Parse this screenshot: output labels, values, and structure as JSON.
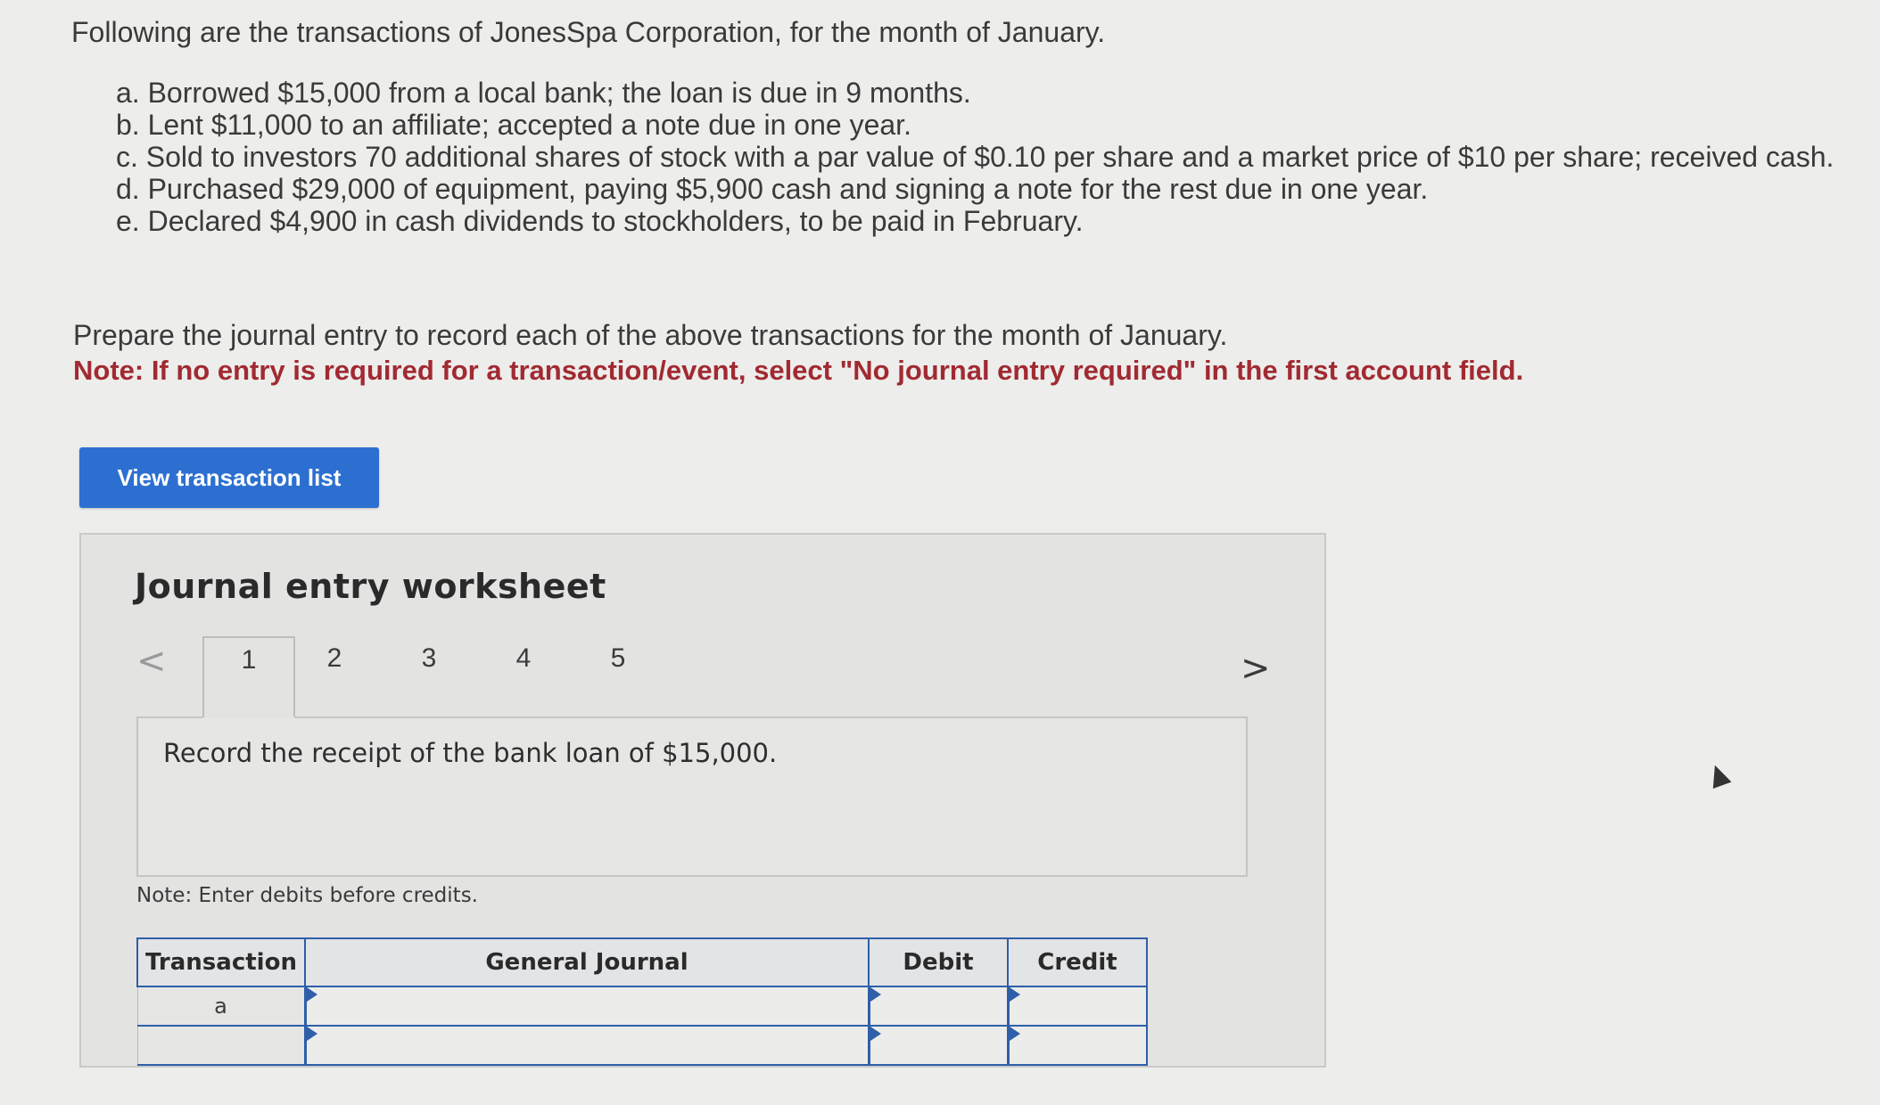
{
  "intro": "Following are the transactions of JonesSpa Corporation, for the month of January.",
  "transactions": [
    "a. Borrowed $15,000 from a local bank; the loan is due in 9 months.",
    "b. Lent $11,000 to an affiliate; accepted a note due in one year.",
    "c. Sold to investors 70 additional shares of stock with a par value of $0.10 per share and a market price of $10 per share; received cash.",
    "d. Purchased $29,000 of equipment, paying $5,900 cash and signing a note for the rest due in one year.",
    "e. Declared $4,900 in cash dividends to stockholders, to be paid in February."
  ],
  "prepare": "Prepare the journal entry to record each of the above transactions for the month of January.",
  "note": "Note: If no entry is required for a transaction/event, select \"No journal entry required\" in the first account field.",
  "view_button": "View transaction list",
  "worksheet": {
    "title": "Journal entry worksheet",
    "prev_icon": "<",
    "next_icon": ">",
    "tabs": [
      "1",
      "2",
      "3",
      "4",
      "5"
    ],
    "active_tab": "1",
    "description": "Record the receipt of the bank loan of $15,000.",
    "enter_note": "Note: Enter debits before credits.",
    "table": {
      "headers": {
        "transaction": "Transaction",
        "general_journal": "General Journal",
        "debit": "Debit",
        "credit": "Credit"
      },
      "rows": [
        {
          "transaction": "a",
          "account": "",
          "debit": "",
          "credit": ""
        },
        {
          "transaction": "",
          "account": "",
          "debit": "",
          "credit": ""
        }
      ]
    }
  },
  "colors": {
    "accent": "#2c6fd1",
    "note_red": "#a12a32",
    "table_border": "#2f5fa8"
  }
}
